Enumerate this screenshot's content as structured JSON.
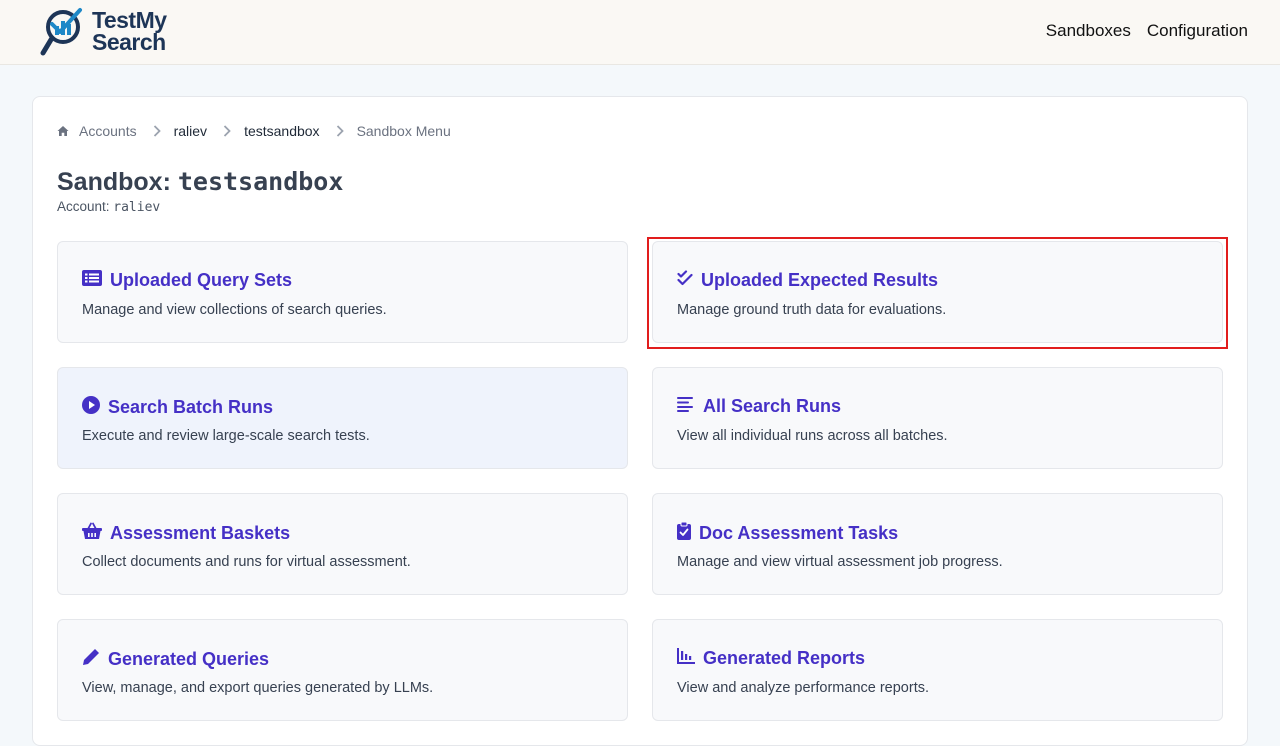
{
  "header": {
    "logo_line1": "TestMy",
    "logo_line2": "Search",
    "nav": [
      "Sandboxes",
      "Configuration"
    ]
  },
  "breadcrumb": [
    "Accounts",
    "raliev",
    "testsandbox",
    "Sandbox Menu"
  ],
  "page": {
    "title_prefix": "Sandbox: ",
    "title_name": "testsandbox",
    "account_label": "Account: ",
    "account_name": "raliev"
  },
  "cards": [
    {
      "title": "Uploaded Query Sets",
      "desc": "Manage and view collections of search queries.",
      "icon": "list-icon"
    },
    {
      "title": "Uploaded Expected Results",
      "desc": "Manage ground truth data for evaluations.",
      "icon": "double-check-icon"
    },
    {
      "title": "Search Batch Runs",
      "desc": "Execute and review large-scale search tests.",
      "icon": "play-circle-icon"
    },
    {
      "title": "All Search Runs",
      "desc": "View all individual runs across all batches.",
      "icon": "lines-icon"
    },
    {
      "title": "Assessment Baskets",
      "desc": "Collect documents and runs for virtual assessment.",
      "icon": "basket-icon"
    },
    {
      "title": "Doc Assessment Tasks",
      "desc": "Manage and view virtual assessment job progress.",
      "icon": "clipboard-check-icon"
    },
    {
      "title": "Generated Queries",
      "desc": "View, manage, and export queries generated by LLMs.",
      "icon": "pencil-icon"
    },
    {
      "title": "Generated Reports",
      "desc": "View and analyze performance reports.",
      "icon": "bar-chart-icon"
    }
  ],
  "colors": {
    "accent": "#4530c6",
    "highlight": "#e11d1d",
    "header_bg": "#faf8f4"
  }
}
